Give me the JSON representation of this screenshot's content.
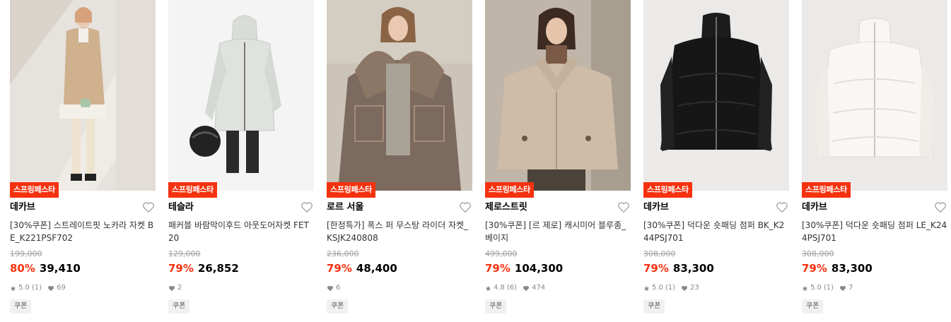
{
  "products": [
    {
      "badge": "스프링페스타",
      "brand": "데카브",
      "name": "[30%쿠폰] 스트레이트핏 노카라 자켓 BE_K221PSF702",
      "original_price": "199,000",
      "discount": "80%",
      "price": "39,410",
      "rating": "5.0",
      "review_count": "(1)",
      "likes": "69",
      "coupon": "쿠폰",
      "image": "beige-blazer-photo",
      "bg": "#e6e2dd"
    },
    {
      "badge": "스프링페스타",
      "brand": "테슬라",
      "name": "패커블 바람막이후드 아웃도어자켓 FET20",
      "original_price": "129,000",
      "discount": "79%",
      "price": "26,852",
      "rating": "",
      "review_count": "",
      "likes": "2",
      "coupon": "쿠폰",
      "image": "gray-windbreaker-photo",
      "bg": "#f4f4f4"
    },
    {
      "badge": "스프링페스타",
      "brand": "로르 서울",
      "name": "[한정특가] 폭스 퍼 무스탕 라이더 자켓_KSJK240808",
      "original_price": "236,000",
      "discount": "79%",
      "price": "48,400",
      "rating": "",
      "review_count": "",
      "likes": "6",
      "coupon": "쿠폰",
      "image": "fur-mustang-photo",
      "bg": "#ccc4b8"
    },
    {
      "badge": "스프링페스타",
      "brand": "제로스트릿",
      "name": "[30%쿠폰] [르 제로] 캐시미어 블루종_베이지",
      "original_price": "499,000",
      "discount": "79%",
      "price": "104,300",
      "rating": "4.8",
      "review_count": "(6)",
      "likes": "474",
      "coupon": "쿠폰",
      "image": "cashmere-blouson-photo",
      "bg": "#bfb5a8"
    },
    {
      "badge": "스프링페스타",
      "brand": "데카브",
      "name": "[30%쿠폰] 덕다운 숏패딩 점퍼 BK_K244PSJ701",
      "original_price": "308,000",
      "discount": "79%",
      "price": "83,300",
      "rating": "5.0",
      "review_count": "(1)",
      "likes": "23",
      "coupon": "쿠폰",
      "image": "black-down-jacket-photo",
      "bg": "#ebeae8"
    },
    {
      "badge": "스프링페스타",
      "brand": "데카브",
      "name": "[30%쿠폰] 덕다운 숏패딩 점퍼 LE_K244PSJ701",
      "original_price": "308,000",
      "discount": "79%",
      "price": "83,300",
      "rating": "5.0",
      "review_count": "(1)",
      "likes": "7",
      "coupon": "쿠폰",
      "image": "white-down-jacket-photo",
      "bg": "#ebeae8"
    }
  ],
  "colors": {
    "accent": "#f5320f",
    "strike": "#a0a0a0",
    "meta": "#888888"
  },
  "icons": {
    "heart_outline": "heart-outline-icon",
    "star": "star-icon",
    "heart_filled": "heart-filled-icon"
  }
}
